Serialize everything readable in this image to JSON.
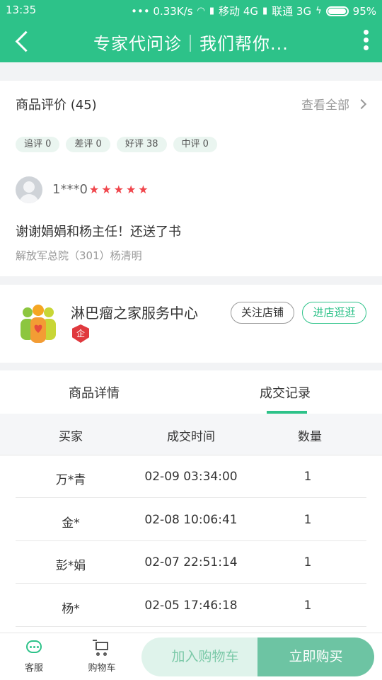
{
  "status_bar": {
    "time": "13:35",
    "speed": "••• 0.33K/s",
    "carrier1": "移动 4G",
    "carrier2": "联通 3G",
    "battery": "95%"
  },
  "header": {
    "title": "专家代问诊｜我们帮你..."
  },
  "reviews": {
    "title": "商品评价 (45)",
    "view_all": "查看全部",
    "tags": [
      "追评 0",
      "差评 0",
      "好评 38",
      "中评 0"
    ],
    "item": {
      "user": "1***0",
      "stars": "★★★★★",
      "text": "谢谢娟娟和杨主任！还送了书",
      "meta": "解放军总院（301）杨清明"
    }
  },
  "shop": {
    "name": "淋巴瘤之家服务中心",
    "badge": "企",
    "follow_label": "关注店铺",
    "visit_label": "进店逛逛"
  },
  "tabs": {
    "detail": "商品详情",
    "records": "成交记录"
  },
  "records_table": {
    "headers": [
      "买家",
      "成交时间",
      "数量"
    ],
    "rows": [
      [
        "万*青",
        "02-09 03:34:00",
        "1"
      ],
      [
        "金*",
        "02-08 10:06:41",
        "1"
      ],
      [
        "彭*娟",
        "02-07 22:51:14",
        "1"
      ],
      [
        "杨*",
        "02-05 17:46:18",
        "1"
      ]
    ]
  },
  "bottom_bar": {
    "service_label": "客服",
    "cart_label": "购物车",
    "add_cart_label": "加入购物车",
    "buy_now_label": "立即购买"
  },
  "colors": {
    "brand": "#2dc289",
    "star": "#f0464c",
    "buy_button": "#6dc4a3"
  }
}
